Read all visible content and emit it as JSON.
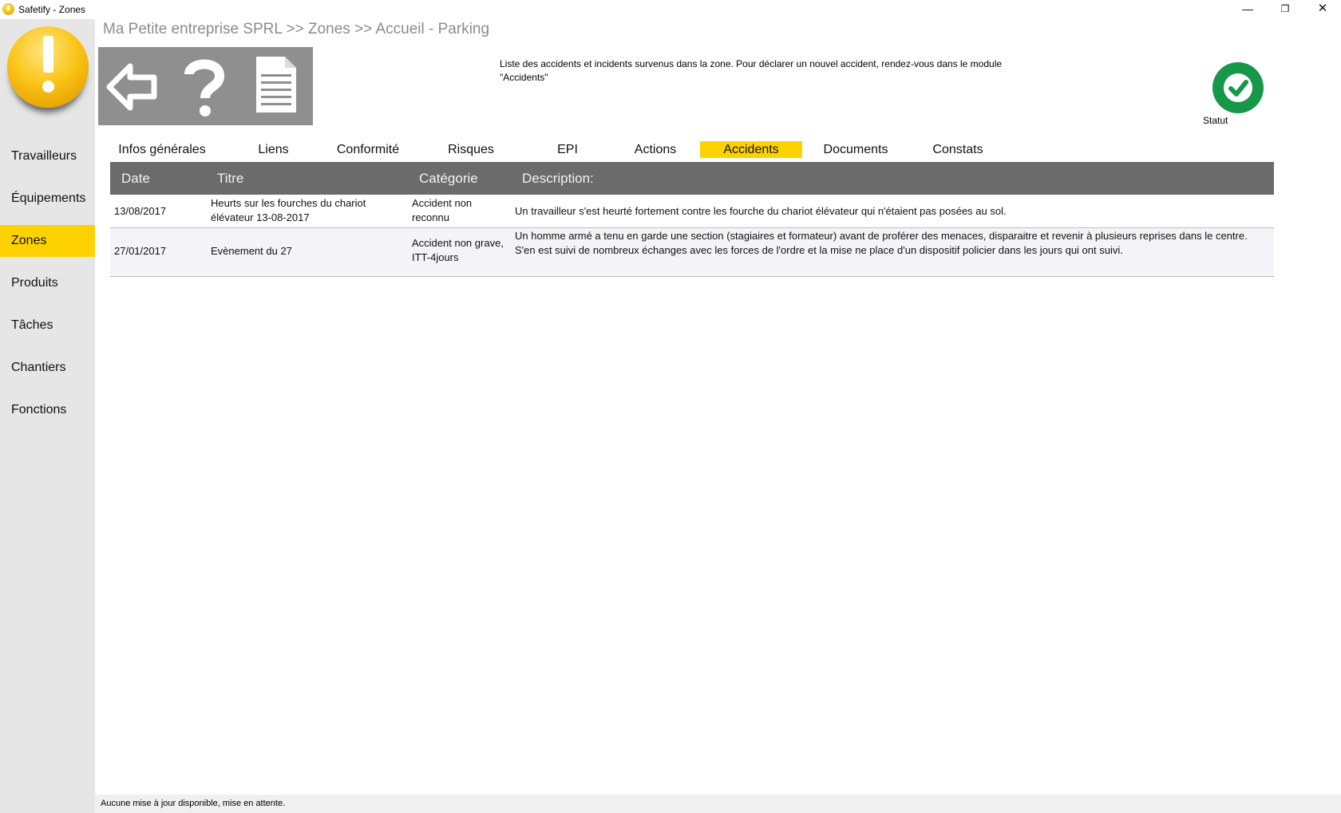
{
  "window": {
    "title": "Safetify - Zones",
    "controls": {
      "minimize": "—",
      "maximize": "❐",
      "close": "✕"
    }
  },
  "sidebar": {
    "items": [
      {
        "label": "Travailleurs",
        "active": false
      },
      {
        "label": "Équipements",
        "active": false
      },
      {
        "label": "Zones",
        "active": true
      },
      {
        "label": "Produits",
        "active": false
      },
      {
        "label": "Tâches",
        "active": false
      },
      {
        "label": "Chantiers",
        "active": false
      },
      {
        "label": "Fonctions",
        "active": false
      }
    ]
  },
  "header": {
    "breadcrumb": "Ma Petite entreprise SPRL >> Zones >> Accueil - Parking",
    "info": "Liste des accidents et incidents survenus dans la zone. Pour déclarer un nouvel accident, rendez-vous dans le module \"Accidents\"",
    "toolbar": {
      "back_icon": "back-arrow-icon",
      "help_icon": "question-mark-icon",
      "doc_icon": "document-icon"
    },
    "statut": {
      "label": "Statut",
      "color": "#16974a"
    }
  },
  "tabs": [
    {
      "label": "Infos générales",
      "active": false
    },
    {
      "label": "Liens",
      "active": false
    },
    {
      "label": "Conformité",
      "active": false
    },
    {
      "label": "Risques",
      "active": false
    },
    {
      "label": "EPI",
      "active": false
    },
    {
      "label": "Actions",
      "active": false
    },
    {
      "label": "Accidents",
      "active": true
    },
    {
      "label": "Documents",
      "active": false
    },
    {
      "label": "Constats",
      "active": false
    }
  ],
  "table": {
    "headers": {
      "date": "Date",
      "titre": "Titre",
      "categorie": "Catégorie",
      "description": "Description:"
    },
    "rows": [
      {
        "date": "13/08/2017",
        "titre": "Heurts sur les fourches du chariot élévateur 13-08-2017",
        "categorie": "Accident non reconnu",
        "description": "Un travailleur s'est heurté fortement contre les fourche du chariot élévateur qui n'étaient pas posées au sol."
      },
      {
        "date": "27/01/2017",
        "titre": "Evènement du 27",
        "categorie": "Accident non grave, ITT-4jours",
        "description_line1": "Un homme armé a tenu en garde une section (stagiaires et formateur) avant de proférer des menaces, disparaitre et revenir à plusieurs reprises dans le centre.",
        "description_line2": "S'en est suivi de nombreux échanges avec les forces de l'ordre et la mise ne place d'un dispositif policier dans les jours qui ont suivi."
      }
    ]
  },
  "status_bar": {
    "message": "Aucune mise à jour disponible, mise en attente."
  },
  "colors": {
    "accent": "#fed201",
    "header_bg": "#6b6b6b",
    "sidebar_bg": "#e6e6e6",
    "toolbar_bg": "#8f8f8f"
  }
}
